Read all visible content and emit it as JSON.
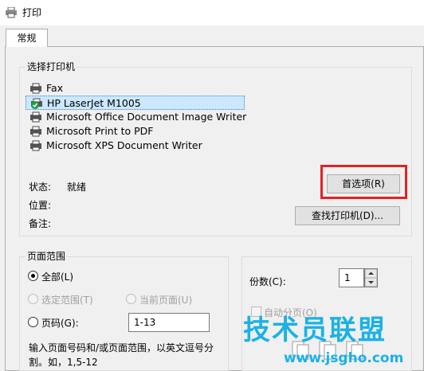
{
  "window": {
    "title": "打印",
    "title_icon": "printer-icon"
  },
  "tabs": [
    {
      "label": "常规",
      "selected": true
    }
  ],
  "select_printer": {
    "title": "选择打印机",
    "printers": [
      {
        "name": "Fax",
        "icon": "fax-printer-icon"
      },
      {
        "name": "HP LaserJet M1005",
        "icon": "default-printer-icon",
        "selected": true,
        "default": true
      },
      {
        "name": "Microsoft Office Document Image Writer",
        "icon": "printer-icon"
      },
      {
        "name": "Microsoft Print to PDF",
        "icon": "printer-icon"
      },
      {
        "name": "Microsoft XPS Document Writer",
        "icon": "printer-icon"
      }
    ],
    "status_label": "状态:",
    "status_value": "就绪",
    "location_label": "位置:",
    "comment_label": "备注:",
    "preferences_button": "首选项(R)",
    "find_printer_button": "查找打印机(D)..."
  },
  "page_range": {
    "title": "页面范围",
    "all_label": "全部(L)",
    "selection_label": "选定范围(T)",
    "current_page_label": "当前页面(U)",
    "pages_label": "页码(G):",
    "pages_value": "1-13",
    "help_text_line1": "输入页面号码和/或页面范围，以英文逗号分",
    "help_text_line2": "割。如，1,5-12"
  },
  "copies": {
    "label": "份数(C):",
    "value": "1",
    "collate_label": "自动分页(O)",
    "collate_checked": false,
    "collate_icon_text": "1 1 2 2 3 3"
  },
  "watermark": {
    "main": "技术员联盟",
    "url": "www.jsgho.com"
  },
  "colors": {
    "highlight": "#e32228",
    "selection": "#cce8ff",
    "watermark": "#1bb1e7"
  }
}
